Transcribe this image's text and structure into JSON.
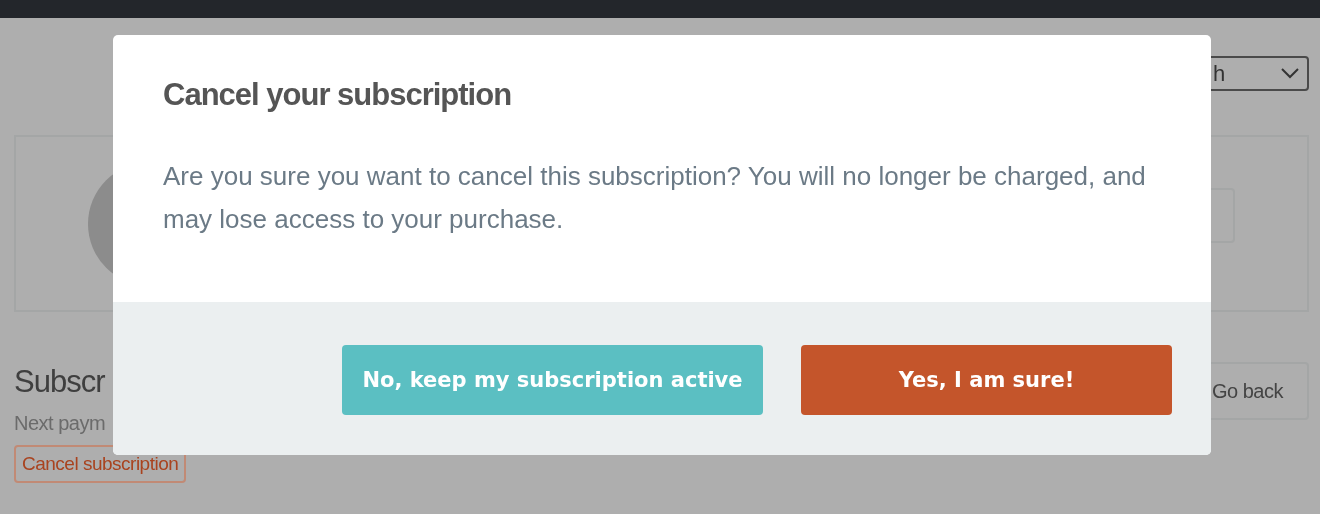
{
  "page": {
    "select": {
      "value": "h"
    },
    "heading": "Subscr",
    "next_payment": "Next paym",
    "cancel_button": "Cancel subscription",
    "back_button": "Go back"
  },
  "modal": {
    "title": "Cancel your subscription",
    "message": "Are you sure you want to cancel this subscription? You will no longer be charged, and may lose access to your purchase.",
    "buttons": [
      {
        "label": "No, keep my subscription active",
        "kind": "secondary"
      },
      {
        "label": "Yes, I am sure!",
        "kind": "danger"
      }
    ]
  }
}
